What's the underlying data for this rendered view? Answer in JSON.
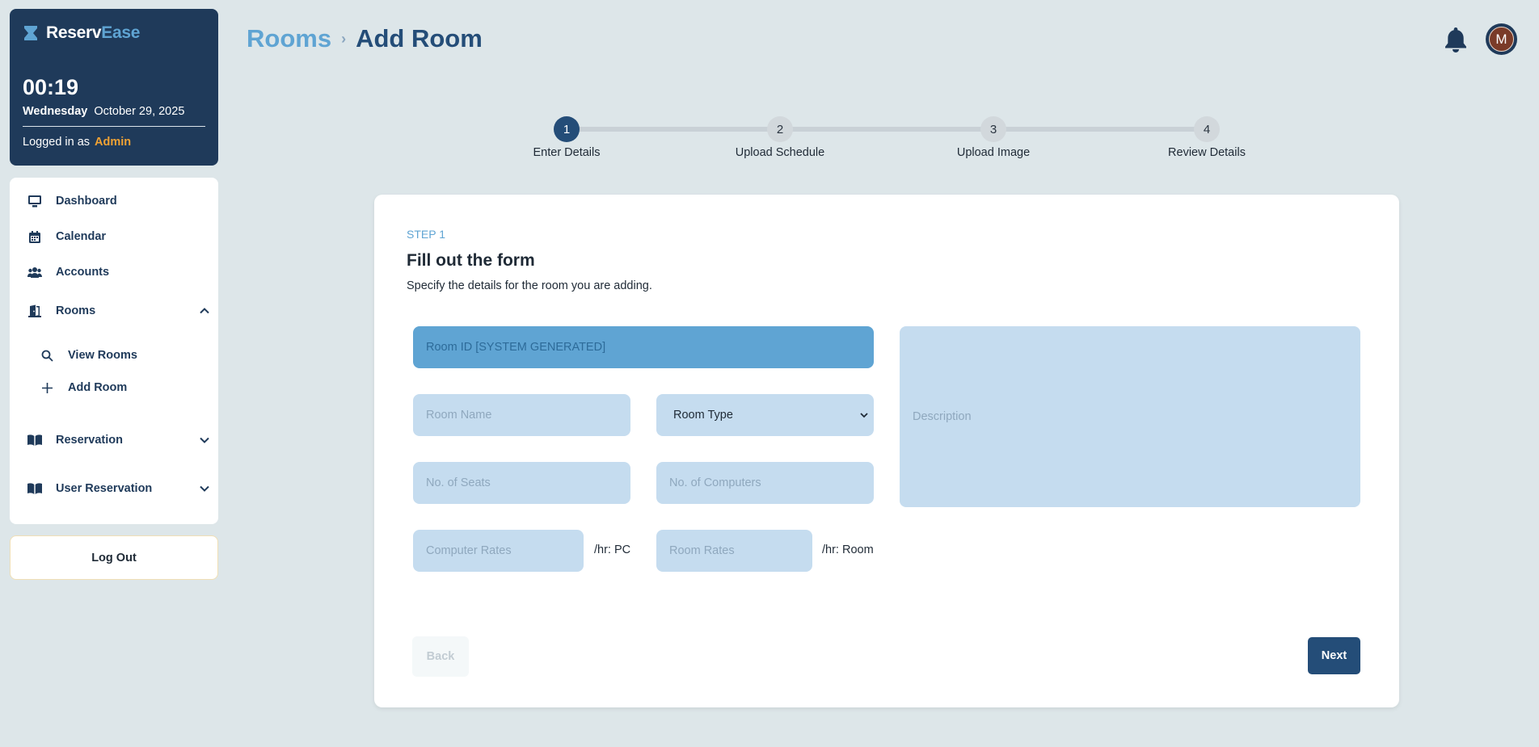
{
  "brand": {
    "name_part1": "Reserv",
    "name_part2": "Ease"
  },
  "clock": {
    "time": "00:19",
    "weekday": "Wednesday",
    "date": "October 29, 2025"
  },
  "login": {
    "prefix": "Logged in as",
    "role": "Admin"
  },
  "sidebar": {
    "items": [
      {
        "label": "Dashboard",
        "icon": "monitor-icon"
      },
      {
        "label": "Calendar",
        "icon": "calendar-icon"
      },
      {
        "label": "Accounts",
        "icon": "users-icon"
      },
      {
        "label": "Rooms",
        "icon": "door-icon",
        "expanded": true
      },
      {
        "label": "Reservation",
        "icon": "book-icon",
        "expanded": false
      },
      {
        "label": "User Reservation",
        "icon": "book-icon",
        "expanded": false
      }
    ],
    "rooms_sub": [
      {
        "label": "View Rooms",
        "icon": "search-icon"
      },
      {
        "label": "Add Room",
        "icon": "plus-icon"
      }
    ],
    "logout_label": "Log Out"
  },
  "header": {
    "crumb_parent": "Rooms",
    "crumb_separator": "›",
    "crumb_current": "Add Room"
  },
  "avatar": {
    "initial": "M"
  },
  "stepper": [
    {
      "num": "1",
      "label": "Enter Details",
      "active": true
    },
    {
      "num": "2",
      "label": "Upload Schedule",
      "active": false
    },
    {
      "num": "3",
      "label": "Upload Image",
      "active": false
    },
    {
      "num": "4",
      "label": "Review Details",
      "active": false
    }
  ],
  "form": {
    "step_label": "STEP 1",
    "title": "Fill out the form",
    "description": "Specify the details for the room you are adding.",
    "room_id_placeholder": "Room ID [SYSTEM GENERATED]",
    "room_name_placeholder": "Room Name",
    "room_type_value": "Room Type",
    "seats_placeholder": "No. of Seats",
    "computers_placeholder": "No. of Computers",
    "computer_rates_placeholder": "Computer Rates",
    "computer_rates_unit": "/hr: PC",
    "room_rates_placeholder": "Room Rates",
    "room_rates_unit": "/hr: Room",
    "description_placeholder": "Description",
    "back_label": "Back",
    "next_label": "Next"
  },
  "colors": {
    "navy": "#1f3a5a",
    "accent": "#5fa4d3",
    "field": "#c5dcef",
    "admin": "#f0a234"
  }
}
